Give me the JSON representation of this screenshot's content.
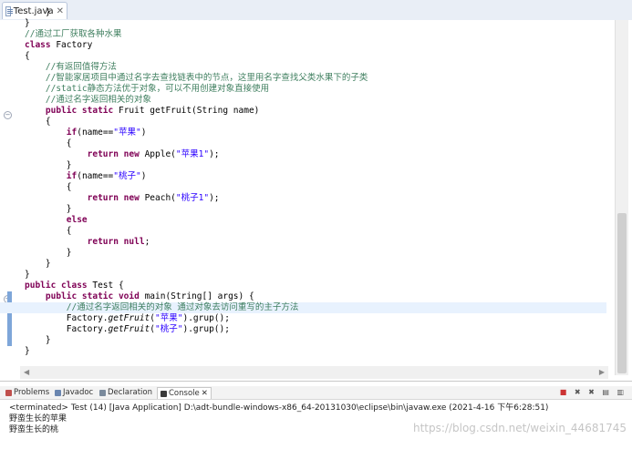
{
  "editor": {
    "tab": {
      "title": "Test.java",
      "close": "✕"
    },
    "lines": [
      [
        {
          "t": "    }"
        }
      ],
      [
        {
          "t": "}"
        }
      ],
      [
        {
          "t": "//通过工厂获取各种水果",
          "c": "cm"
        }
      ],
      [
        {
          "t": "class",
          "c": "kw"
        },
        {
          "t": " Factory"
        }
      ],
      [
        {
          "t": "{"
        }
      ],
      [
        {
          "t": "    "
        },
        {
          "t": "//有返回值得方法",
          "c": "cm"
        }
      ],
      [
        {
          "t": "    "
        },
        {
          "t": "//智能家居项目中通过名字去查找链表中的节点，这里用名字查找父类水果下的子类",
          "c": "cm"
        }
      ],
      [
        {
          "t": "    "
        },
        {
          "t": "//static静态方法优于对象，可以不用创建对象直接使用",
          "c": "cm"
        }
      ],
      [
        {
          "t": "    "
        },
        {
          "t": "//通过名字返回相关的对象",
          "c": "cm"
        }
      ],
      [
        {
          "t": "    "
        },
        {
          "t": "public static",
          "c": "kw"
        },
        {
          "t": " Fruit getFruit(String name)"
        }
      ],
      [
        {
          "t": "    {"
        }
      ],
      [
        {
          "t": "        "
        },
        {
          "t": "if",
          "c": "kw"
        },
        {
          "t": "(name=="
        },
        {
          "t": "\"苹果\"",
          "c": "str"
        },
        {
          "t": ")"
        }
      ],
      [
        {
          "t": "        {"
        }
      ],
      [
        {
          "t": "            "
        },
        {
          "t": "return new",
          "c": "kw"
        },
        {
          "t": " Apple("
        },
        {
          "t": "\"苹果1\"",
          "c": "str"
        },
        {
          "t": ");"
        }
      ],
      [
        {
          "t": "        }"
        }
      ],
      [
        {
          "t": "        "
        },
        {
          "t": "if",
          "c": "kw"
        },
        {
          "t": "(name=="
        },
        {
          "t": "\"桃子\"",
          "c": "str"
        },
        {
          "t": ")"
        }
      ],
      [
        {
          "t": "        {"
        }
      ],
      [
        {
          "t": "            "
        },
        {
          "t": "return new",
          "c": "kw"
        },
        {
          "t": " Peach("
        },
        {
          "t": "\"桃子1\"",
          "c": "str"
        },
        {
          "t": ");"
        }
      ],
      [
        {
          "t": "        }"
        }
      ],
      [
        {
          "t": "        "
        },
        {
          "t": "else",
          "c": "kw"
        }
      ],
      [
        {
          "t": "        {"
        }
      ],
      [
        {
          "t": "            "
        },
        {
          "t": "return null",
          "c": "kw"
        },
        {
          "t": ";"
        }
      ],
      [
        {
          "t": "        }"
        }
      ],
      [
        {
          "t": "    }"
        }
      ],
      [
        {
          "t": "}"
        }
      ],
      [
        {
          "t": "public class",
          "c": "kw"
        },
        {
          "t": " Test {"
        }
      ],
      [
        {
          "t": "    "
        },
        {
          "t": "public static void",
          "c": "kw"
        },
        {
          "t": " main(String[] args) {"
        }
      ],
      [
        {
          "t": "        "
        },
        {
          "t": "//通过名字返回相关的对象 通过对象去访问重写的主子方法",
          "c": "cm"
        }
      ],
      [
        {
          "t": "        Factory."
        },
        {
          "t": "getFruit",
          "c": "it"
        },
        {
          "t": "("
        },
        {
          "t": "\"苹果\"",
          "c": "str"
        },
        {
          "t": ").grup();"
        }
      ],
      [
        {
          "t": "        Factory."
        },
        {
          "t": "getFruit",
          "c": "it"
        },
        {
          "t": "("
        },
        {
          "t": "\"桃子\"",
          "c": "str"
        },
        {
          "t": ").grup();"
        }
      ],
      [
        {
          "t": "    }"
        }
      ],
      [
        {
          "t": "}"
        }
      ]
    ],
    "highlight_line": 27
  },
  "panel": {
    "tabs": [
      {
        "label": "Problems",
        "icon": "problems-icon",
        "color": "#c0504d"
      },
      {
        "label": "Javadoc",
        "icon": "javadoc-icon",
        "color": "#6a86b0"
      },
      {
        "label": "Declaration",
        "icon": "declaration-icon",
        "color": "#7a8a9c"
      },
      {
        "label": "Console",
        "icon": "console-icon",
        "color": "#3a3a3a",
        "active": true
      }
    ],
    "close": "✕"
  },
  "console": {
    "header": "<terminated> Test (14) [Java Application] D:\\adt-bundle-windows-x86_64-20131030\\eclipse\\bin\\javaw.exe (2021-4-16 下午6:28:51)",
    "output": [
      "野蛮生长的苹果",
      "野蛮生长的桃"
    ]
  },
  "watermark": "https://blog.csdn.net/weixin_44681745"
}
